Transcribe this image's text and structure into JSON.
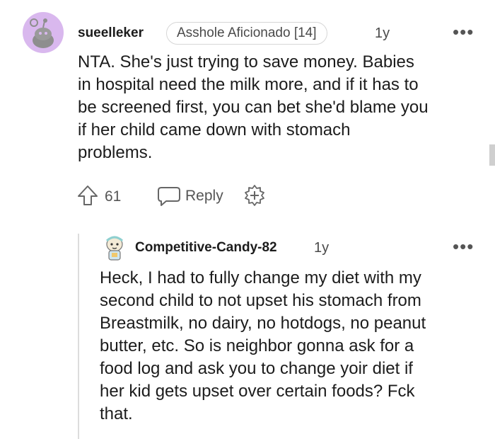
{
  "comment": {
    "username": "sueelleker",
    "flair": "Asshole Aficionado [14]",
    "age": "1y",
    "more_label": "•••",
    "lines": [
      "NTA. She's just trying to save money. Babies",
      "in hospital need the milk more, and if it has to",
      "be screened first, you can bet she'd blame you",
      "if her child came down with stomach",
      "problems."
    ],
    "upvotes": "61",
    "reply_label": "Reply",
    "colors": {
      "avatar_bg": "#d9b8ee"
    }
  },
  "reply": {
    "username": "Competitive-Candy-82",
    "age": "1y",
    "more_label": "•••",
    "lines": [
      "Heck, I had to fully change my diet with my",
      "second child to not upset his stomach from",
      "Breastmilk, no dairy, no hotdogs, no peanut",
      "butter, etc. So is neighbor gonna ask for a",
      "food log and ask you to change yoir diet if",
      "her kid gets upset over certain foods? Fck",
      "that."
    ]
  }
}
